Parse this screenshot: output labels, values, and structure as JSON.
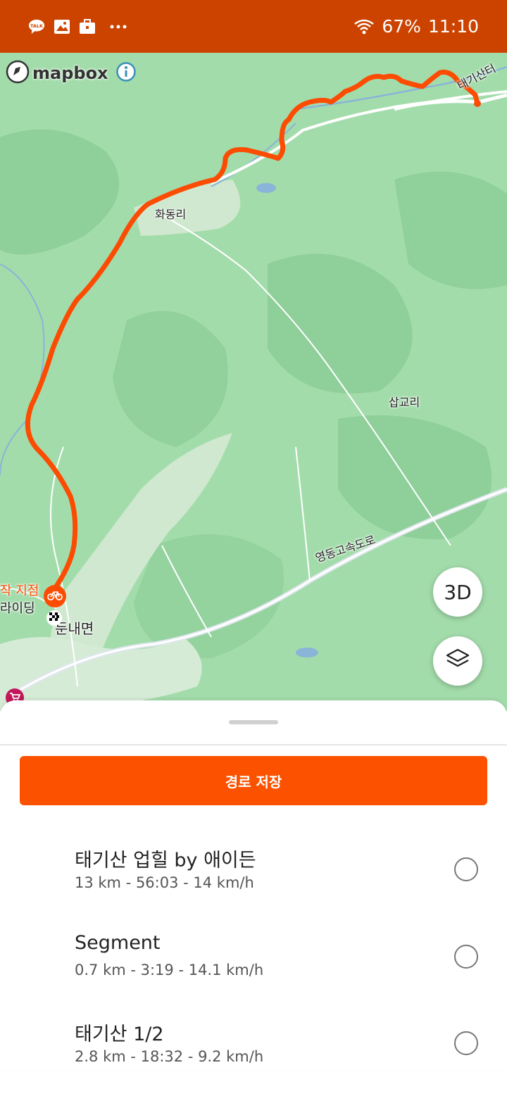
{
  "status_bar": {
    "battery": "67%",
    "time": "11:10",
    "icons": [
      "kakaotalk-icon",
      "gallery-icon",
      "briefcase-icon",
      "more-icon",
      "wifi-icon"
    ],
    "talk_badge": "TALK"
  },
  "map": {
    "attribution": "mapbox",
    "labels": {
      "hwadong": "화동리",
      "sapgyo": "삽교리",
      "expressway": "영동고속도로",
      "dunnae": "둔내면",
      "taegi": "태기산터",
      "start_point": "작 지점",
      "riding": "라이딩"
    },
    "btn_3d": "3D",
    "route_color": "#fc4c02"
  },
  "sheet": {
    "save_button": "경로 저장",
    "routes": [
      {
        "name": "태기산 업힐 by 애이든",
        "meta": "13 km - 56:03 - 14 km/h"
      },
      {
        "name": "Segment",
        "meta": "0.7 km - 3:19 - 14.1 km/h"
      },
      {
        "name": "태기산 1/2",
        "meta": "2.8 km - 18:32 - 9.2 km/h"
      }
    ]
  }
}
